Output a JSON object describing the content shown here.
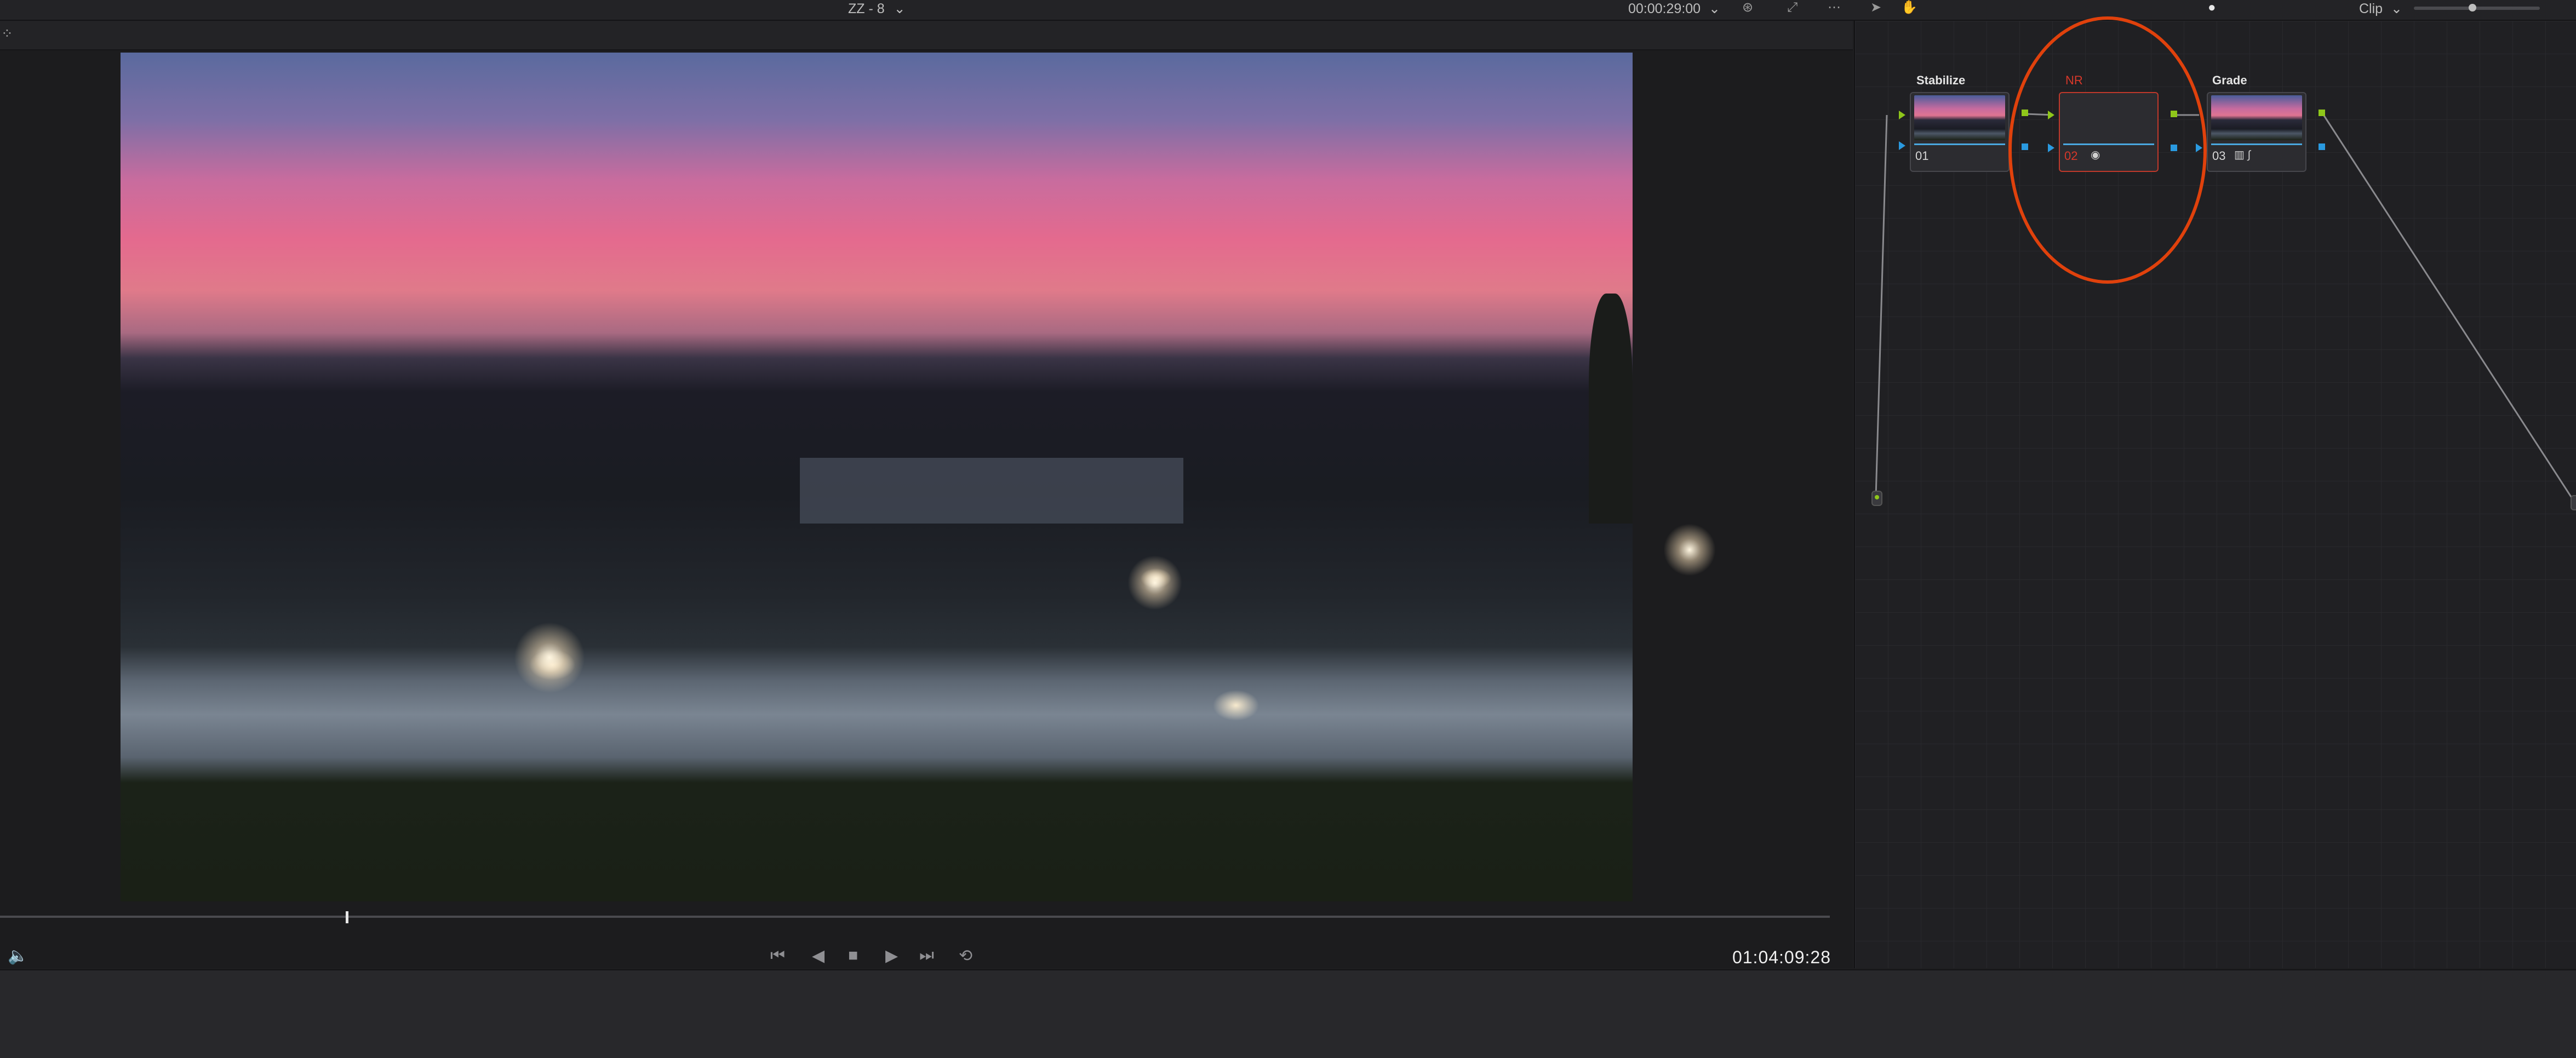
{
  "viewer": {
    "clip_name": "ZZ - 8",
    "duration_timecode": "00:00:29:00",
    "current_timecode": "01:04:09:28",
    "playhead_fraction": 0.189
  },
  "node_editor": {
    "mode": "Clip",
    "nodes": [
      {
        "label": "Stabilize",
        "number": "01",
        "has_thumbnail": true
      },
      {
        "label": "NR",
        "number": "02",
        "has_thumbnail": false,
        "highlighted": true,
        "label_color": "#d8382a"
      },
      {
        "label": "Grade",
        "number": "03",
        "has_thumbnail": true
      }
    ]
  },
  "colors": {
    "highlight": "#e0410c",
    "pin_green": "#8fc71a",
    "pin_blue": "#2a9ae0"
  },
  "icons": {
    "volume": "volume-icon",
    "transport": [
      "skip-to-start-icon",
      "play-reverse-icon",
      "stop-icon",
      "play-icon",
      "skip-to-end-icon",
      "loop-icon"
    ]
  }
}
